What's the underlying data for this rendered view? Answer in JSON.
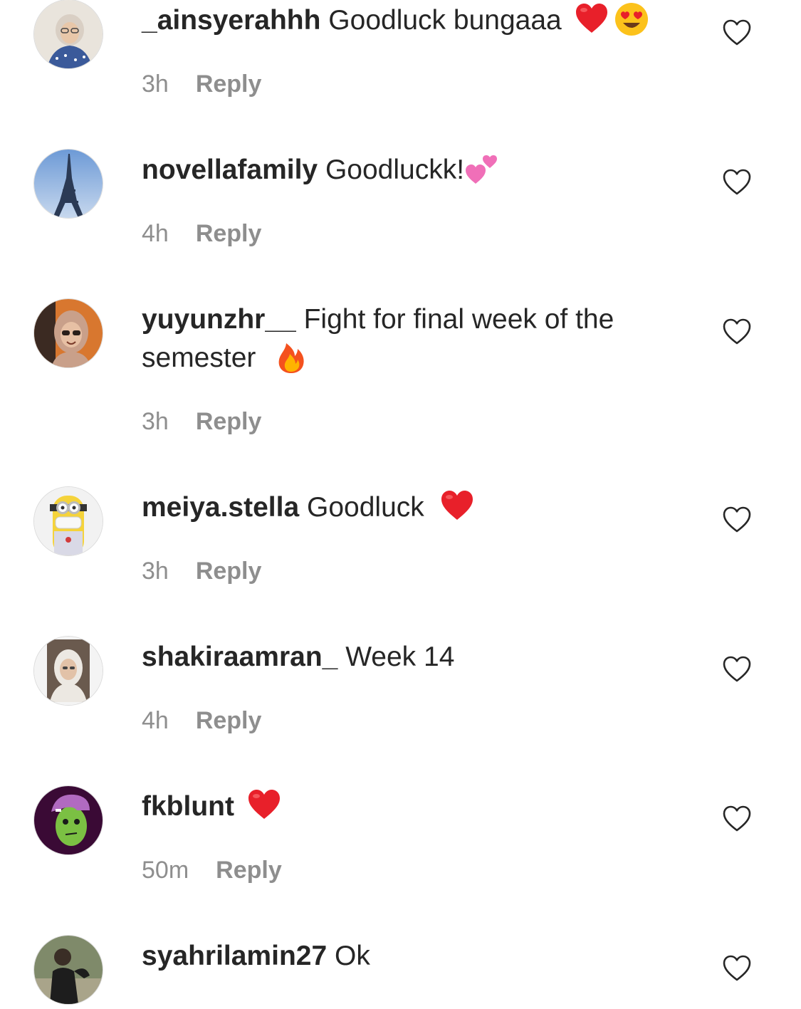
{
  "comments": [
    {
      "username": "_ainsyerahhh",
      "text": "Goodluck bungaaa",
      "emojis": [
        "red-heart-emoji",
        "heart-eyes-emoji"
      ],
      "time": "3h",
      "reply_label": "Reply",
      "avatar_icon": "avatar-ainsyerahhh"
    },
    {
      "username": "novellafamily",
      "text": "Goodluckk!",
      "emojis": [
        "two-hearts-emoji"
      ],
      "time": "4h",
      "reply_label": "Reply",
      "avatar_icon": "avatar-novellafamily"
    },
    {
      "username": "yuyunzhr__",
      "text": "Fight for final week of the semester",
      "emojis": [
        "fire-emoji"
      ],
      "time": "3h",
      "reply_label": "Reply",
      "avatar_icon": "avatar-yuyunzhr"
    },
    {
      "username": "meiya.stella",
      "text": "Goodluck",
      "emojis": [
        "red-heart-emoji"
      ],
      "time": "3h",
      "reply_label": "Reply",
      "avatar_icon": "avatar-meiya-stella"
    },
    {
      "username": "shakiraamran_",
      "text": "Week 14",
      "emojis": [],
      "time": "4h",
      "reply_label": "Reply",
      "avatar_icon": "avatar-shakiraamran"
    },
    {
      "username": "fkblunt",
      "text": "",
      "emojis": [
        "red-heart-emoji"
      ],
      "time": "50m",
      "reply_label": "Reply",
      "avatar_icon": "avatar-fkblunt"
    },
    {
      "username": "syahrilamin27",
      "text": "Ok",
      "emojis": [],
      "time": "",
      "reply_label": "",
      "avatar_icon": "avatar-syahrilamin27"
    }
  ],
  "colors": {
    "text": "#262626",
    "meta": "#8e8e8e",
    "heart_outline": "#262626",
    "emoji_red": "#e8202a"
  }
}
